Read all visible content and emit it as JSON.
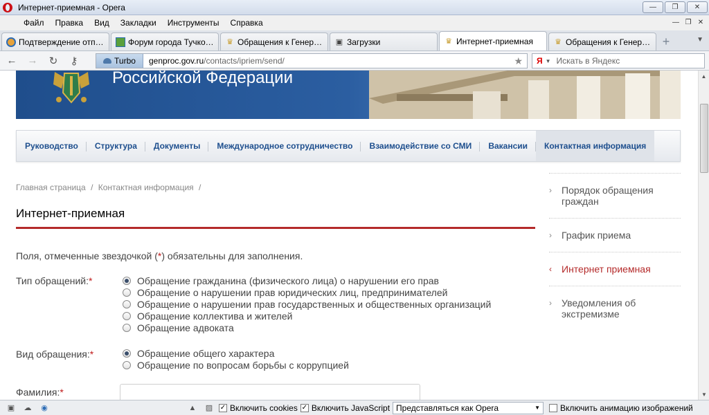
{
  "window": {
    "title": "Интернет-приемная - Opera",
    "controls": [
      "—",
      "❐",
      "✕"
    ]
  },
  "menu": [
    "Файл",
    "Правка",
    "Вид",
    "Закладки",
    "Инструменты",
    "Справка"
  ],
  "tabs": [
    {
      "label": "Подтверждение отпра...",
      "icon": "opera-icon",
      "active": false
    },
    {
      "label": "Форум города Тучков...",
      "icon": "forum-icon",
      "active": false
    },
    {
      "label": "Обращения к Генерал...",
      "icon": "emblem-icon",
      "active": false
    },
    {
      "label": "Загрузки",
      "icon": "downloads-icon",
      "active": false
    },
    {
      "label": "Интернет-приемная",
      "icon": "emblem-icon",
      "active": true
    },
    {
      "label": "Обращения к Генерал...",
      "icon": "emblem-icon",
      "active": false
    }
  ],
  "address": {
    "turbo": "Turbo",
    "domain": "genproc.gov.ru",
    "path": "/contacts/ipriem/send/",
    "search_placeholder": "Искать в Яндекс",
    "search_logo": "Я"
  },
  "banner": {
    "title": "Российской Федерации"
  },
  "main_nav": [
    {
      "label": "Руководство",
      "active": false
    },
    {
      "label": "Структура",
      "active": false
    },
    {
      "label": "Документы",
      "active": false
    },
    {
      "label": "Международное сотрудничество",
      "active": false
    },
    {
      "label": "Взаимодействие со СМИ",
      "active": false
    },
    {
      "label": "Вакансии",
      "active": false
    },
    {
      "label": "Контактная информация",
      "active": true
    }
  ],
  "breadcrumb": [
    "Главная страница",
    "/",
    "Контактная информация",
    "/"
  ],
  "page_title": "Интернет-приемная",
  "note": {
    "before": "Поля, отмеченные звездочкой (",
    "star": "*",
    "after": ") обязательны для заполнения."
  },
  "form": {
    "type_label": "Тип обращений:",
    "type_options": [
      {
        "label": "Обращение гражданина (физического лица) о нарушении его прав",
        "checked": true
      },
      {
        "label": "Обращение о нарушении прав юридических лиц, предпринимателей",
        "checked": false
      },
      {
        "label": "Обращение о нарушении прав государственных и общественных организаций",
        "checked": false
      },
      {
        "label": "Обращение коллектива и жителей",
        "checked": false
      },
      {
        "label": "Обращение адвоката",
        "checked": false
      }
    ],
    "kind_label": "Вид обращения:",
    "kind_options": [
      {
        "label": "Обращение общего характера",
        "checked": true
      },
      {
        "label": "Обращение по вопросам борьбы с коррупцией",
        "checked": false
      }
    ],
    "surname_label": "Фамилия:",
    "surname_value": "",
    "required_mark": "*"
  },
  "sidebar": [
    {
      "label": "Порядок обращения граждан",
      "active": false
    },
    {
      "label": "График приема",
      "active": false
    },
    {
      "label": "Интернет приемная",
      "active": true
    },
    {
      "label": "Уведомления об экстремизме",
      "active": false
    }
  ],
  "statusbar": {
    "cookies": {
      "label": "Включить cookies",
      "checked": true
    },
    "javascript": {
      "label": "Включить JavaScript",
      "checked": true
    },
    "identity": "Представляться как Opera",
    "animation": {
      "label": "Включить анимацию изображений",
      "checked": false
    }
  },
  "colors": {
    "accent_red": "#b42a2a",
    "nav_blue": "#1e4f8e",
    "banner_blue": "#2b5ea1"
  }
}
